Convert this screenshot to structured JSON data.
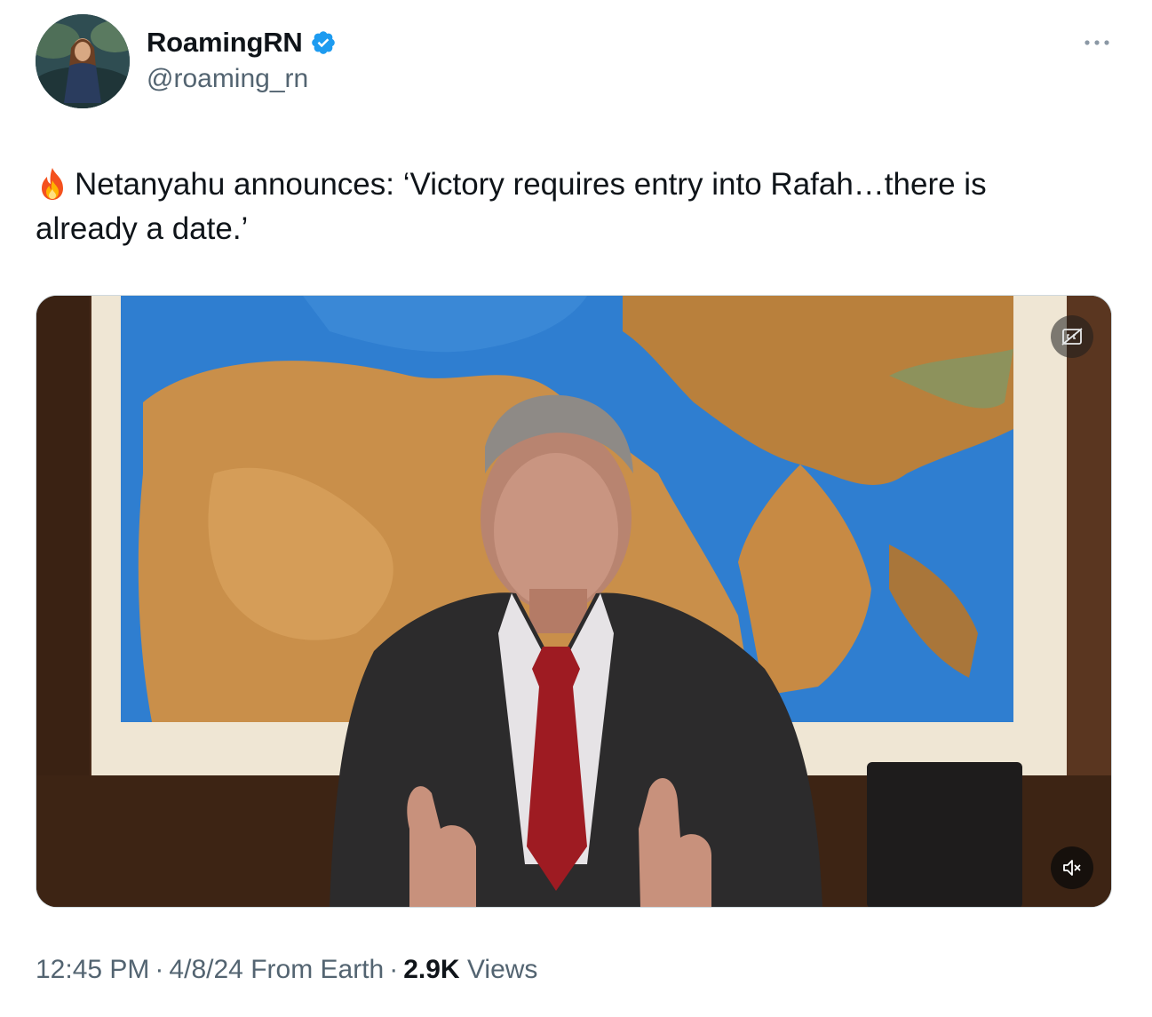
{
  "author": {
    "display_name": "RoamingRN",
    "handle": "@roaming_rn",
    "verified": true,
    "verified_color": "#1d9bf0"
  },
  "tweet": {
    "emoji_icon": "fire-icon",
    "text_line1": "Netanyahu announces: ‘Victory requires entry into Rafah…there is",
    "text_line2": "already a date.’"
  },
  "media": {
    "type": "video",
    "cc_icon": "captions-off-icon",
    "volume_icon": "muted-speaker-icon"
  },
  "meta": {
    "time": "12:45 PM",
    "date": "4/8/24",
    "source": "From Earth",
    "separator": "·",
    "views_count": "2.9K",
    "views_label": "Views"
  },
  "colors": {
    "text_primary": "#0f1419",
    "text_secondary": "#536471",
    "border": "#cfd9de"
  }
}
